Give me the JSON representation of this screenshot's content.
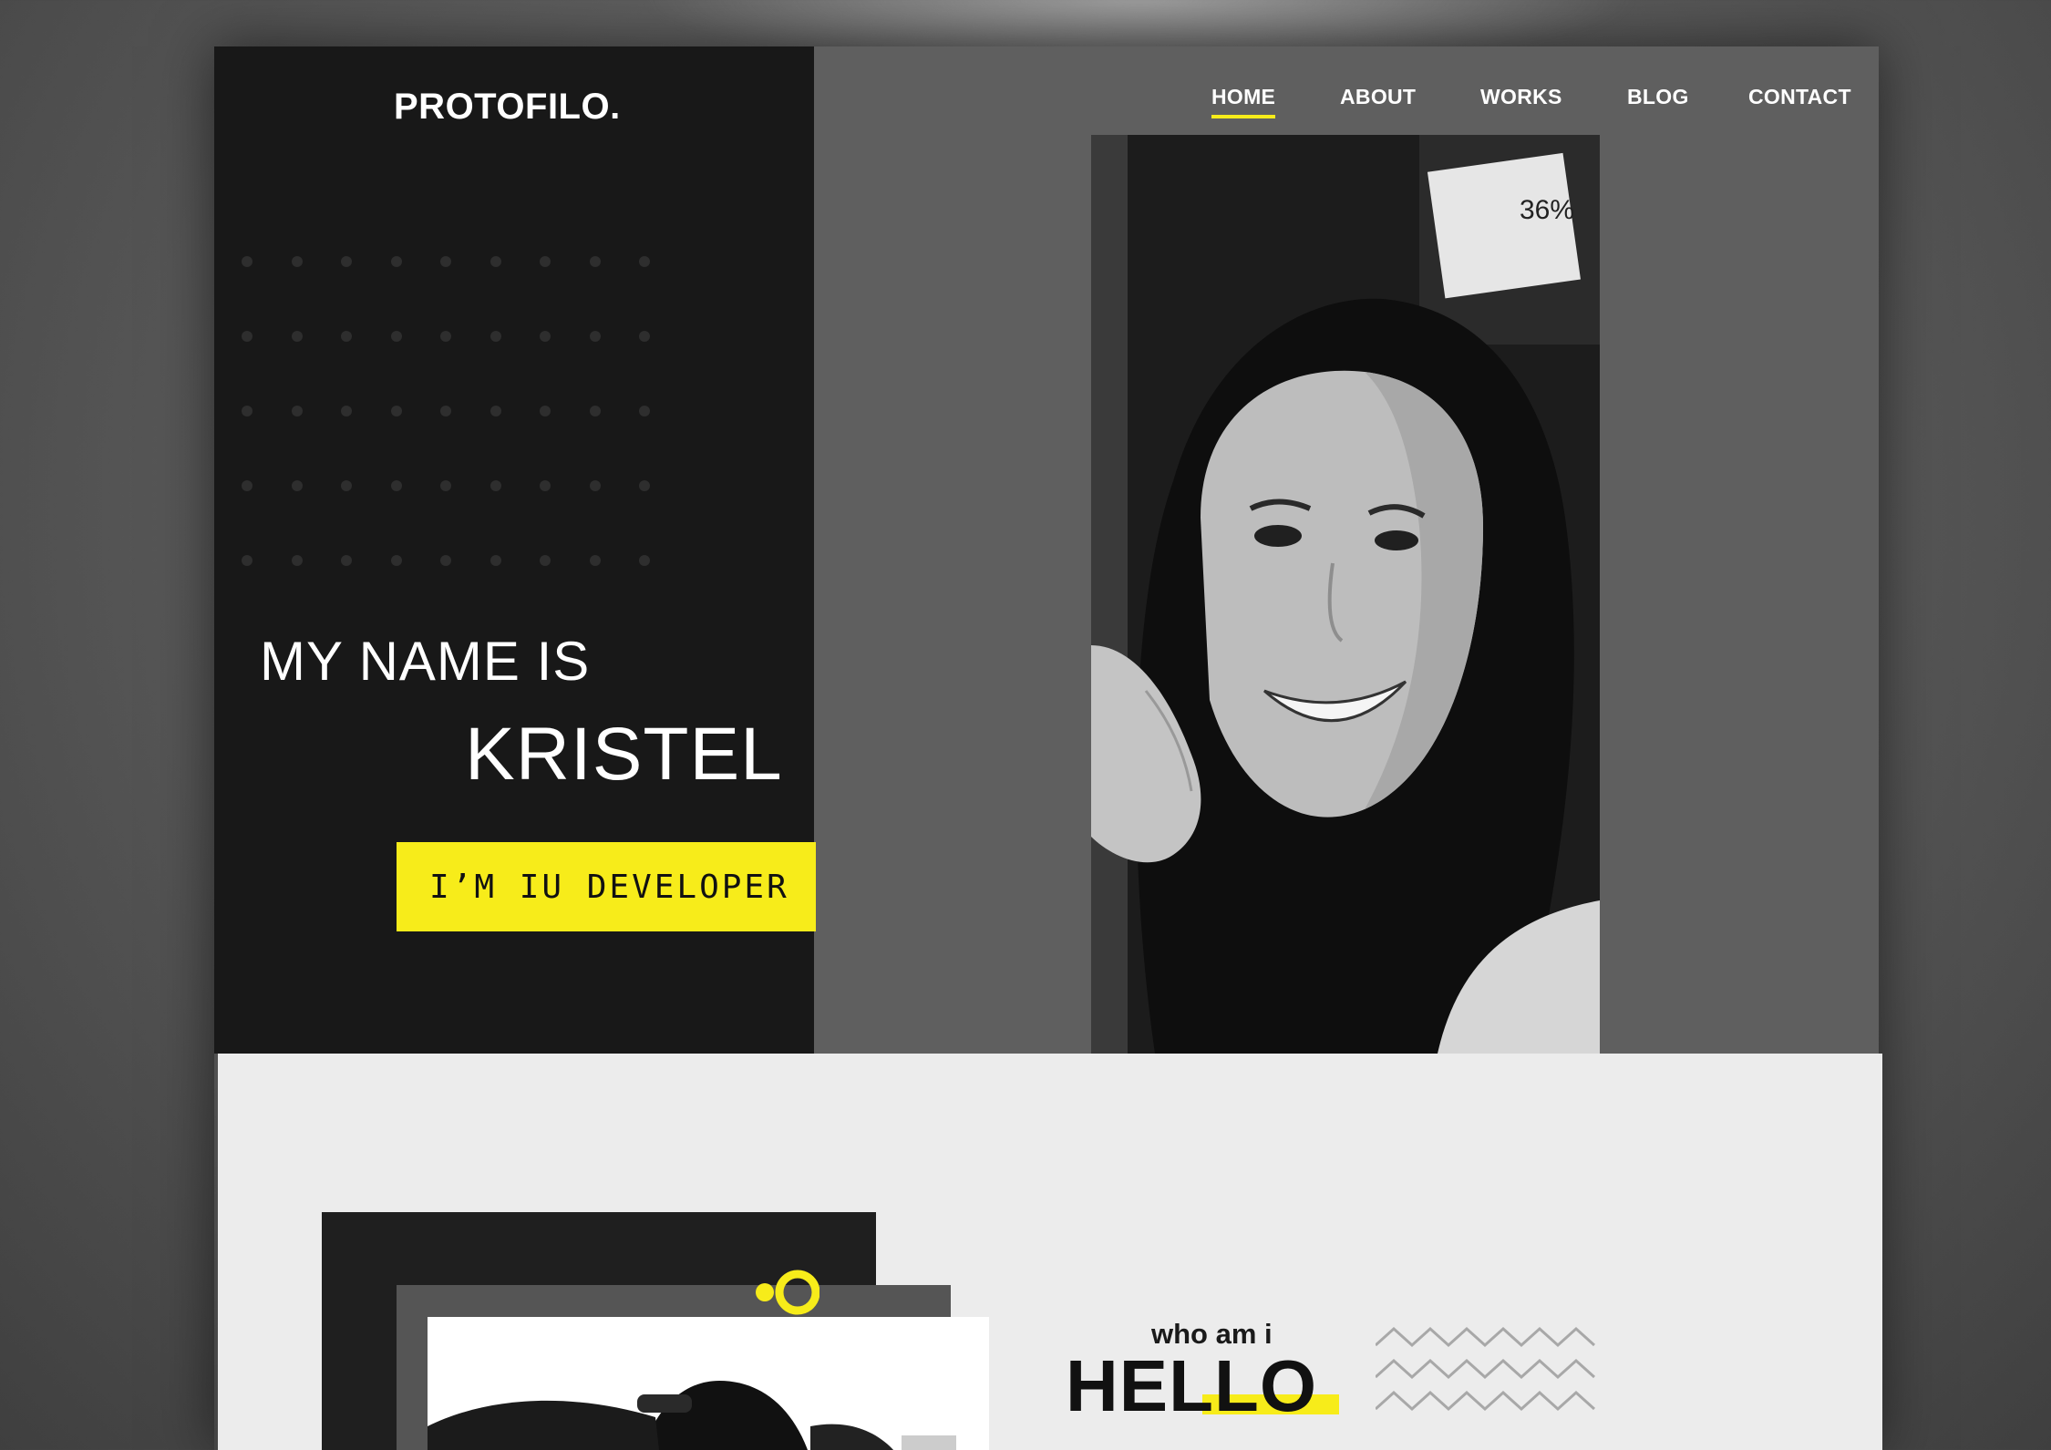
{
  "brand": {
    "logo": "PROTOFILO."
  },
  "nav": {
    "items": [
      {
        "label": "HOME",
        "active": true
      },
      {
        "label": "ABOUT",
        "active": false
      },
      {
        "label": "WORKS",
        "active": false
      },
      {
        "label": "BLOG",
        "active": false
      },
      {
        "label": "CONTACT",
        "active": false
      }
    ]
  },
  "hero": {
    "intro": "MY NAME IS",
    "name": "KRISTEL",
    "role_button": "I’M IU DEVELOPER",
    "portrait_sign": "36%"
  },
  "about": {
    "kicker": "who am i",
    "heading": "HELLO"
  },
  "colors": {
    "accent": "#f7ec1a",
    "dark": "#181818",
    "hero_gray": "#5f5f5f",
    "light": "#ececec"
  }
}
